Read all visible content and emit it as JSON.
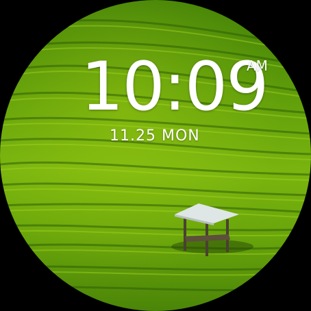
{
  "watch_face": {
    "time": "10:09",
    "ampm": "AM",
    "date": "11.25",
    "weekday": "MON"
  },
  "background": {
    "subject": "rice-terrace-field-with-hut",
    "colors": {
      "dark_green": "#3f7e07",
      "mid_green": "#6aa60b",
      "light_green": "#8cc614",
      "terrace_shadow": "#2f5f05",
      "hut_roof": "#dfe6e6",
      "hut_frame": "#4a4030"
    }
  },
  "colors": {
    "text": "#ffffff",
    "bezel": "#000000"
  }
}
